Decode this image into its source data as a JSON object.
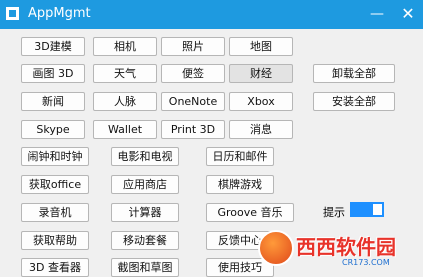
{
  "window": {
    "title": "AppMgmt",
    "minimize": "—",
    "close": "✕"
  },
  "apps": {
    "r0": [
      "3D建模",
      "相机",
      "照片",
      "地图"
    ],
    "r1": [
      "画图 3D",
      "天气",
      "便签",
      "财经"
    ],
    "r2": [
      "新闻",
      "人脉",
      "OneNote",
      "Xbox"
    ],
    "r3": [
      "Skype",
      "Wallet",
      "Print 3D",
      "消息"
    ],
    "r4": [
      "闹钟和时钟",
      "电影和电视",
      "日历和邮件"
    ],
    "r5": [
      "获取office",
      "应用商店",
      "棋牌游戏"
    ],
    "r6": [
      "录音机",
      "计算器",
      "Groove 音乐"
    ],
    "r7": [
      "获取帮助",
      "移动套餐",
      "反馈中心"
    ],
    "r8": [
      "3D 查看器",
      "截图和草图",
      "使用技巧"
    ]
  },
  "actions": {
    "uninstall_all": "卸载全部",
    "install_all": "安装全部"
  },
  "hint": {
    "label": "提示",
    "enabled": true
  },
  "watermark": {
    "brand": "西西软件园",
    "url": "CR173.COM"
  }
}
